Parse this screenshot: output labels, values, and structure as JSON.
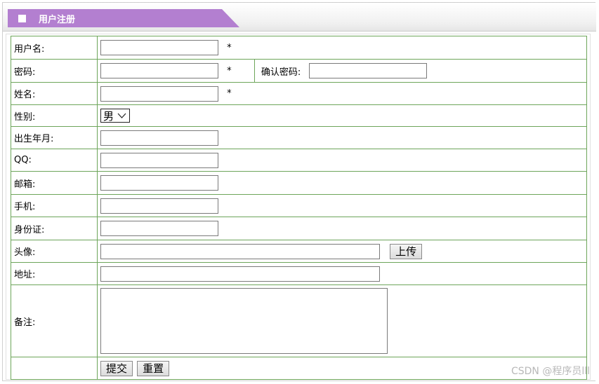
{
  "header": {
    "title": "用户注册"
  },
  "form": {
    "username_label": "用户名:",
    "password_label": "密码:",
    "confirm_password_label": "确认密码:",
    "realname_label": "姓名:",
    "gender_label": "性别:",
    "gender_selected": "男",
    "birth_label": "出生年月:",
    "qq_label": "QQ:",
    "email_label": "邮箱:",
    "phone_label": "手机:",
    "idcard_label": "身份证:",
    "avatar_label": "头像:",
    "address_label": "地址:",
    "remark_label": "备注:",
    "required_mark": "*",
    "upload_button": "上传",
    "submit_button": "提交",
    "reset_button": "重置"
  },
  "watermark": "CSDN @程序员lll",
  "colors": {
    "header_tab": "#b37fd0",
    "table_border": "#6da55a"
  }
}
